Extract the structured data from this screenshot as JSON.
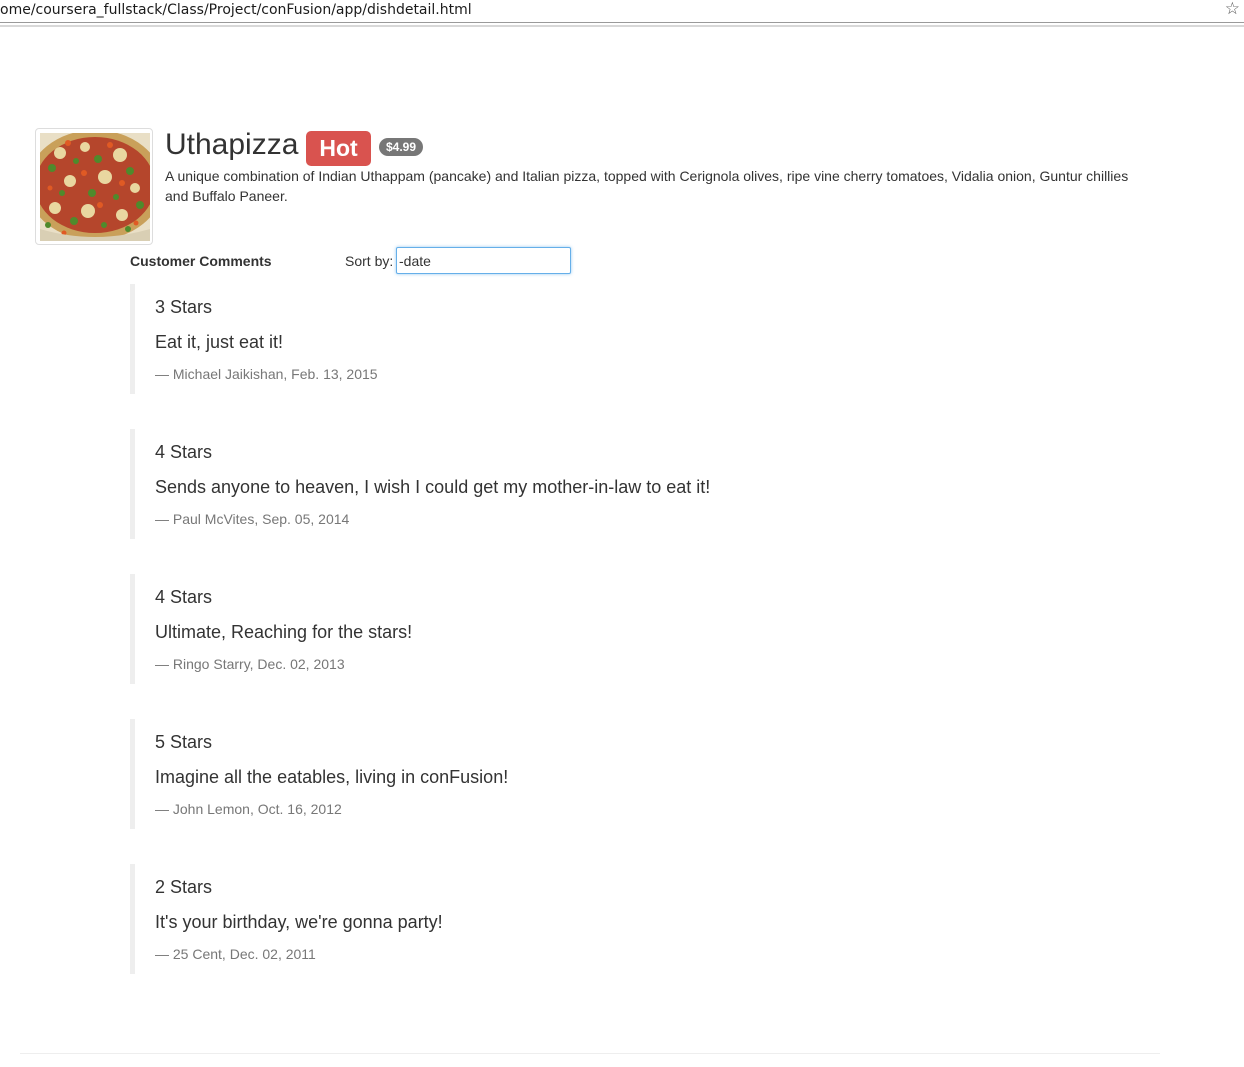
{
  "browser": {
    "url": "ome/coursera_fullstack/Class/Project/conFusion/app/dishdetail.html",
    "bookmark_icon": "star-icon"
  },
  "dish": {
    "image_alt": "Uthapizza",
    "name": "Uthapizza",
    "label": "Hot",
    "price": "$4.99",
    "description": "A unique combination of Indian Uthappam (pancake) and Italian pizza, topped with Cerignola olives, ripe vine cherry tomatoes, Vidalia onion, Guntur chillies and Buffalo Paneer."
  },
  "comments_section": {
    "title": "Customer Comments",
    "sort_label": "Sort by:",
    "sort_value": "-date"
  },
  "comments": [
    {
      "rating": "3 Stars",
      "text": "Eat it, just eat it!",
      "footer": "— Michael Jaikishan, Feb. 13, 2015"
    },
    {
      "rating": "4 Stars",
      "text": "Sends anyone to heaven, I wish I could get my mother-in-law to eat it!",
      "footer": "— Paul McVites, Sep. 05, 2014"
    },
    {
      "rating": "4 Stars",
      "text": "Ultimate, Reaching for the stars!",
      "footer": "— Ringo Starry, Dec. 02, 2013"
    },
    {
      "rating": "5 Stars",
      "text": "Imagine all the eatables, living in conFusion!",
      "footer": "— John Lemon, Oct. 16, 2012"
    },
    {
      "rating": "2 Stars",
      "text": "It's your birthday, we're gonna party!",
      "footer": "— 25 Cent, Dec. 02, 2011"
    }
  ],
  "colors": {
    "label_danger": "#d9534f",
    "badge": "#777777",
    "input_focus": "#66afe9",
    "quote_border": "#eeeeee"
  }
}
